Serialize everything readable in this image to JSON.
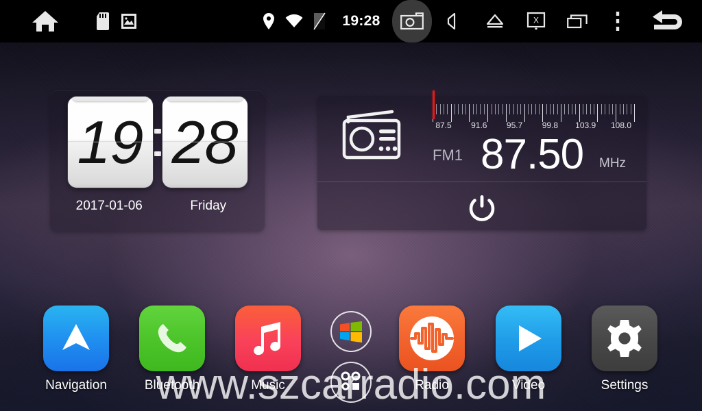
{
  "status_bar": {
    "time": "19:28",
    "icons_left": [
      {
        "name": "home-icon",
        "label": "Home"
      },
      {
        "name": "sd-card-icon",
        "label": "SD Card"
      },
      {
        "name": "gallery-icon",
        "label": "Gallery"
      }
    ],
    "icons_center": [
      {
        "name": "location-icon",
        "label": "GPS"
      },
      {
        "name": "wifi-icon",
        "label": "Wi-Fi"
      },
      {
        "name": "sim-card-icon",
        "label": "SIM"
      }
    ],
    "icons_right": [
      {
        "name": "camera-icon",
        "label": "Camera",
        "highlighted": true
      },
      {
        "name": "mute-icon",
        "label": "Mute"
      },
      {
        "name": "eject-icon",
        "label": "Eject"
      },
      {
        "name": "screen-off-icon",
        "label": "Screen Off"
      },
      {
        "name": "recent-apps-icon",
        "label": "Recent Apps"
      },
      {
        "name": "overflow-menu-icon",
        "label": "Menu"
      },
      {
        "name": "back-icon",
        "label": "Back"
      }
    ]
  },
  "clock_widget": {
    "hours": "19",
    "minutes": "28",
    "date": "2017-01-06",
    "weekday": "Friday"
  },
  "radio_widget": {
    "band": "FM1",
    "frequency": "87.50",
    "unit": "MHz",
    "scale_labels": [
      "87.5",
      "91.6",
      "95.7",
      "99.8",
      "103.9",
      "108.0"
    ],
    "scale_min": 87.5,
    "scale_max": 108.0,
    "marker_frequency": 87.5,
    "marker_color": "#e01b1b",
    "power_label": "Power"
  },
  "dock": {
    "apps": [
      {
        "label": "Navigation",
        "icon": "navigation-arrow-icon",
        "color": "#1f8ff0"
      },
      {
        "label": "Bluetooth",
        "icon": "phone-handset-icon",
        "color": "#4cc42a"
      },
      {
        "label": "Music",
        "icon": "music-note-icon",
        "color": "#f9415a"
      },
      {
        "label": "Radio",
        "icon": "waveform-icon",
        "color": "#f2622c"
      },
      {
        "label": "Video",
        "icon": "play-triangle-icon",
        "color": "#1f9be8"
      },
      {
        "label": "Settings",
        "icon": "gear-icon",
        "color": "#474747"
      }
    ],
    "circle_apps": [
      {
        "icon": "windows-logo-icon",
        "label": "Windows"
      },
      {
        "icon": "face-icon",
        "label": "Face"
      }
    ]
  },
  "watermark": {
    "text": "www.szcarradio.com"
  }
}
